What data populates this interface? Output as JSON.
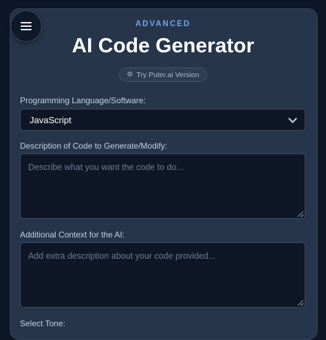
{
  "menu": {
    "icon": "hamburger-menu-icon"
  },
  "header": {
    "eyebrow": "ADVANCED",
    "title": "AI Code Generator",
    "alt_version_icon": "gear-icon",
    "alt_version_label": "Try Puter.ai Version"
  },
  "form": {
    "language": {
      "label": "Programming Language/Software:",
      "value": "JavaScript"
    },
    "description": {
      "label": "Description of Code to Generate/Modify:",
      "placeholder": "Describe what you want the code to do..."
    },
    "context": {
      "label": "Additional Context for the AI:",
      "placeholder": "Add extra description about your code provided..."
    },
    "tone": {
      "label": "Select Tone:"
    }
  },
  "colors": {
    "page_bg": "#0e1728",
    "card_bg": "#26354a",
    "accent": "#69a6f2",
    "field_bg": "#0f1727"
  }
}
